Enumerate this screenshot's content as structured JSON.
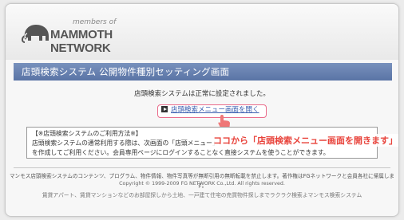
{
  "header": {
    "logo_members": "members of",
    "logo_name": "MAMMOTH NETWORK"
  },
  "titlebar": {
    "title": "店頭検索システム 公開物件種別セッティング画面"
  },
  "main": {
    "status_text": "店頭検索システムは正常に設定されました。",
    "open_link_label": "店頭検索メニュー画面を開く",
    "callout_text": "ココから「店頭検索メニュー画面を開きます」"
  },
  "info_box": {
    "heading": "【※店頭検索システムのご利用方法※】",
    "line1": "店頭検索システムの通常利用する際は、次画面の「店頭メニュー」",
    "line2": "を作成してご利用ください。会員専用ページにログインすることなく直接システムを使うことができます。"
  },
  "footer": {
    "notice": "マンモス店頭検索システムのコンテンツ、プログラム、物件情報、物件写真等が無断引用の無断転載を禁止します。著作権はFGネットワークと会員各社に帰属します。",
    "copyright": "Copyright © 1999-2009 FG NETWORK Co.,Ltd. All rights reserved.",
    "tagline": "賃貸アパート、賃貸マンションなどのお部屋探しから土地、一戸建て住宅の売買物件探しまでラクラク検索よマンモス検索システム"
  },
  "colors": {
    "title_bar": "#6680b0",
    "callout": "#e8433b",
    "link_border": "#ea6b8a",
    "link_text": "#3a5fb0"
  }
}
